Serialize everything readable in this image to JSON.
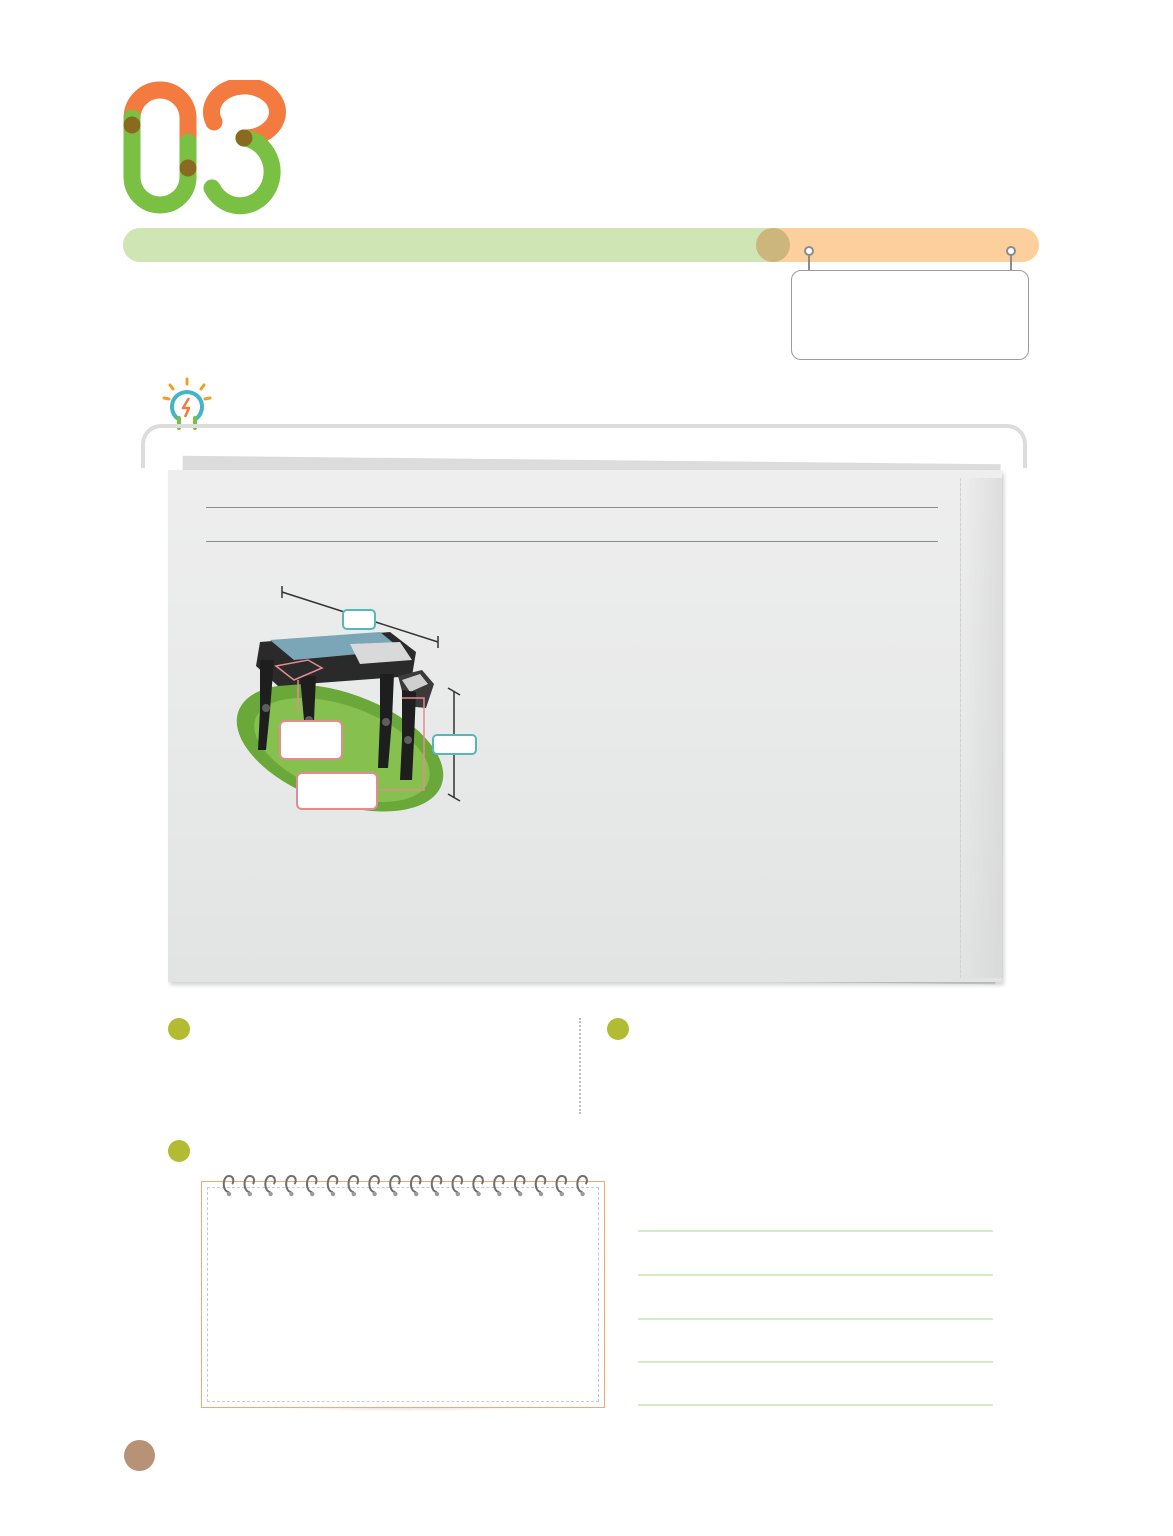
{
  "chapter": {
    "number": "03",
    "colors": {
      "green": "#7ac143",
      "orange": "#f47b3f",
      "overlap": "#8a6a1e"
    }
  },
  "progress": {
    "value": 0.71,
    "filled_color": "#cfe6b4",
    "remaining_color": "#fdcf9c",
    "knob_color": "#cdb67c"
  },
  "sign": {
    "text": ""
  },
  "idea_panel": {
    "icon": "lightbulb-icon",
    "newspaper": {
      "headline": "",
      "article_text": "",
      "robot_figure": {
        "icon": "quadruped-robot-illustration",
        "callouts": [
          "",
          ""
        ],
        "dimension_tags": [
          "",
          ""
        ]
      }
    }
  },
  "sections": {
    "left": {
      "bullet_color": "#b3bb32",
      "text": ""
    },
    "right": {
      "bullet_color": "#b3bb32",
      "text": ""
    },
    "bottom": {
      "bullet_color": "#b3bb32",
      "notepad_text": "",
      "answer_lines": [
        "",
        "",
        "",
        "",
        ""
      ]
    }
  },
  "page_marker": {
    "color": "#b89277"
  }
}
